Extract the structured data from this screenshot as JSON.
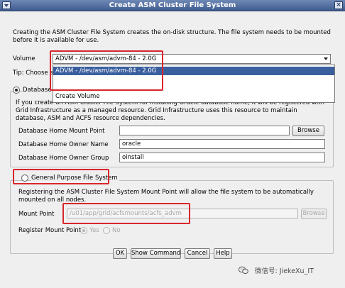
{
  "window": {
    "title": "Create ASM Cluster File System"
  },
  "intro_text": "Creating the ASM Cluster File System creates the on-disk structure. The file system needs to be mounted before it is available for use.",
  "volume": {
    "label": "Volume",
    "selected": "ADVM - /dev/asm/advm-84 - 2.0G",
    "options": [
      "ADVM - /dev/asm/advm-84 - 2.0G",
      "Create Volume"
    ]
  },
  "tip_text": "Tip: Choose s",
  "db_home": {
    "radio_label": "Database Home File System",
    "selected": true,
    "description": "If you create an ASM Cluster File System for installing Oracle database home, it will be registered with Grid Infrastructure as a managed resource. Grid Infrastructure uses this resource to maintain database, ASM and ACFS resource dependencies.",
    "mount_point_label": "Database Home Mount Point",
    "mount_point_value": "",
    "browse_label": "Browse",
    "owner_name_label": "Database Home Owner Name",
    "owner_name_value": "oracle",
    "owner_group_label": "Database Home Owner Group",
    "owner_group_value": "oinstall"
  },
  "general_purpose": {
    "radio_label": "General Purpose File System",
    "selected": false,
    "description": "Registering the ASM Cluster File System Mount Point will allow the file system to be automatically mounted on all nodes.",
    "mount_point_label": "Mount Point",
    "mount_point_value": "/u01/app/grid/acfsmounts/acfs_advm",
    "browse_label": "Browse",
    "register_label": "Register Mount Point",
    "yes_label": "Yes",
    "no_label": "No",
    "register_selected": "Yes"
  },
  "buttons": {
    "ok": "OK",
    "show_command": "Show Command",
    "cancel": "Cancel",
    "help": "Help"
  },
  "watermark": {
    "text": "微信号: JiekeXu_IT"
  },
  "colors": {
    "titlebar": "#4a6494",
    "selection": "#3a5f9e",
    "highlight_box": "#d8262c"
  }
}
